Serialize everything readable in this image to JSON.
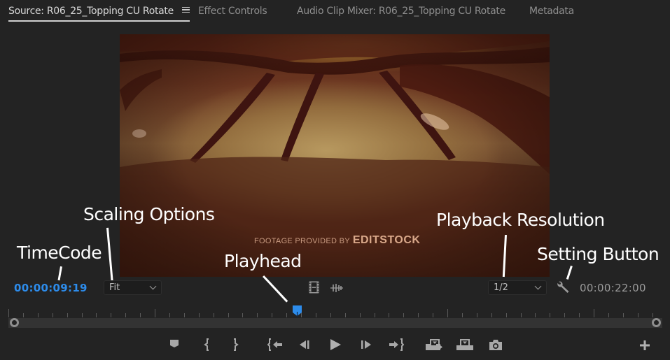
{
  "tabs": [
    {
      "label": "Source: R06_25_Topping CU Rotate",
      "active": true
    },
    {
      "label": "Effect Controls",
      "active": false
    },
    {
      "label": "Audio Clip Mixer: R06_25_Topping CU Rotate",
      "active": false
    },
    {
      "label": "Metadata",
      "active": false
    }
  ],
  "video": {
    "watermark_prefix": "Footage Provided By",
    "watermark_brand": "EDITSTOCK"
  },
  "annotations": {
    "timecode": "TimeCode",
    "scaling": "Scaling Options",
    "playhead": "Playhead",
    "resolution": "Playback Resolution",
    "settings": "Setting Button"
  },
  "controls": {
    "current_timecode": "00:00:09:19",
    "duration_timecode": "00:00:22:00",
    "scaling_selected": "Fit",
    "resolution_selected": "1/2",
    "playhead_position_fraction": 0.441,
    "accent_color": "#2d8ceb"
  },
  "transport": [
    {
      "name": "add-marker",
      "icon": "marker-icon"
    },
    {
      "name": "mark-in",
      "icon": "mark-in-icon"
    },
    {
      "name": "mark-out",
      "icon": "mark-out-icon"
    },
    {
      "name": "go-to-in",
      "icon": "go-to-in-icon"
    },
    {
      "name": "step-back",
      "icon": "step-back-icon"
    },
    {
      "name": "play",
      "icon": "play-icon"
    },
    {
      "name": "step-forward",
      "icon": "step-forward-icon"
    },
    {
      "name": "go-to-out",
      "icon": "go-to-out-icon"
    },
    {
      "name": "insert",
      "icon": "insert-icon"
    },
    {
      "name": "overwrite",
      "icon": "overwrite-icon"
    },
    {
      "name": "export-frame",
      "icon": "camera-icon"
    },
    {
      "name": "button-editor",
      "icon": "plus-icon"
    }
  ]
}
